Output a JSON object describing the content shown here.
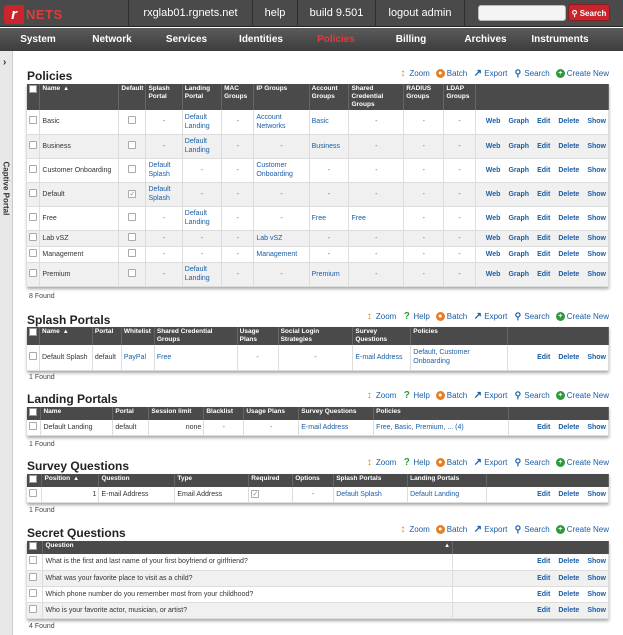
{
  "topbar": {
    "logo_letter": "r",
    "logo_text": "NETS",
    "host": "rxglab01.rgnets.net",
    "help": "help",
    "build": "build 9.501",
    "logout": "logout admin",
    "search_btn": "Search",
    "search_placeholder": ""
  },
  "nav": [
    "System",
    "Network",
    "Services",
    "Identities",
    "Policies",
    "Billing",
    "Archives",
    "Instruments"
  ],
  "sidebar": {
    "label": "Captive Portal"
  },
  "tools": {
    "zoom": "Zoom",
    "batch": "Batch",
    "export": "Export",
    "search": "Search",
    "new": "Create New",
    "help": "Help"
  },
  "actions": {
    "web": "Web",
    "graph": "Graph",
    "edit": "Edit",
    "delete": "Delete",
    "show": "Show"
  },
  "policies": {
    "title": "Policies",
    "headers": [
      "Name",
      "Default",
      "Splash Portal",
      "Landing Portal",
      "MAC Groups",
      "IP Groups",
      "Account Groups",
      "Shared Credential Groups",
      "RADIUS Groups",
      "LDAP Groups"
    ],
    "rows": [
      [
        "Basic",
        "",
        "-",
        "Default Landing",
        "-",
        "Account Networks",
        "Basic",
        "-",
        "-",
        "-"
      ],
      [
        "Business",
        "",
        "-",
        "Default Landing",
        "-",
        "-",
        "Business",
        "-",
        "-",
        "-"
      ],
      [
        "Customer Onboarding",
        "",
        "Default Splash",
        "-",
        "-",
        "Customer Onboarding",
        "-",
        "-",
        "-",
        "-"
      ],
      [
        "Default",
        "✓",
        "Default Splash",
        "-",
        "-",
        "-",
        "-",
        "-",
        "-",
        "-"
      ],
      [
        "Free",
        "",
        "-",
        "Default Landing",
        "-",
        "-",
        "Free",
        "Free",
        "-",
        "-"
      ],
      [
        "Lab vSZ",
        "",
        "-",
        "-",
        "-",
        "Lab vSZ",
        "-",
        "-",
        "-",
        "-"
      ],
      [
        "Management",
        "",
        "-",
        "-",
        "-",
        "Management",
        "-",
        "-",
        "-",
        "-"
      ],
      [
        "Premium",
        "",
        "-",
        "Default Landing",
        "-",
        "-",
        "Premium",
        "-",
        "-",
        "-"
      ]
    ],
    "found": "8 Found"
  },
  "splash": {
    "title": "Splash Portals",
    "headers": [
      "Name",
      "Portal",
      "Whitelist",
      "Shared Credential Groups",
      "Usage Plans",
      "Social Login Strategies",
      "Survey Questions",
      "Policies"
    ],
    "rows": [
      [
        "Default Splash",
        "default",
        "PayPal",
        "Free",
        "-",
        "-",
        "E-mail Address",
        "Default, Customer Onboarding"
      ]
    ],
    "found": "1 Found"
  },
  "landing": {
    "title": "Landing Portals",
    "headers": [
      "Name",
      "Portal",
      "Session limit",
      "Blacklist",
      "Usage Plans",
      "Survey Questions",
      "Policies"
    ],
    "rows": [
      [
        "Default Landing",
        "default",
        "none",
        "-",
        "-",
        "E-mail Address",
        "Free, Basic, Premium, ... (4)"
      ]
    ],
    "found": "1 Found"
  },
  "survey": {
    "title": "Survey Questions",
    "headers": [
      "Position",
      "Question",
      "Type",
      "Required",
      "Options",
      "Splash Portals",
      "Landing Portals"
    ],
    "rows": [
      [
        "1",
        "E-mail Address",
        "Email Address",
        "✓",
        "-",
        "Default Splash",
        "Default Landing"
      ]
    ],
    "found": "1 Found"
  },
  "secret": {
    "title": "Secret Questions",
    "headers": [
      "Question"
    ],
    "rows": [
      [
        "What is the first and last name of your first boyfriend or girlfriend?"
      ],
      [
        "What was your favorite place to visit as a child?"
      ],
      [
        "Which phone number do you remember most from your childhood?"
      ],
      [
        "Who is your favorite actor, musician, or artist?"
      ]
    ],
    "found": "4 Found"
  }
}
